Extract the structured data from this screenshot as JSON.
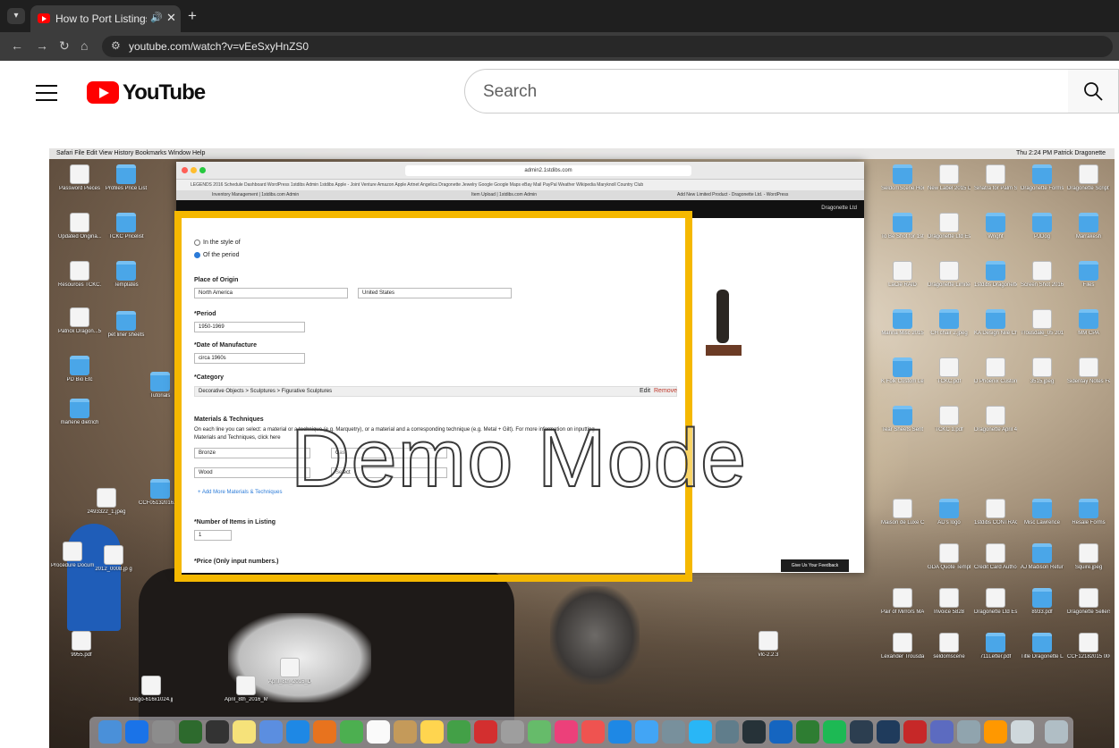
{
  "browser": {
    "tab_title": "How to Port Listings from",
    "new_tab_symbol": "+",
    "url": "youtube.com/watch?v=vEeSxyHnZS0"
  },
  "youtube": {
    "logo_text": "YouTube",
    "search_placeholder": "Search"
  },
  "video": {
    "mac_menubar_left": "Safari   File   Edit   View   History   Bookmarks   Window   Help",
    "mac_menubar_right": "Thu 2:24 PM   Patrick Dragonette",
    "inner_url": "admin2.1stdibs.com",
    "inner_bookmarks": "LEGENDS 2016 Schedule   Dashboard   WordPress   1stdibs   Admin 1stdibs   Apple - Joint Venture   Amazon   Apple   Artnet   Angelica   Dragonette Jewelry   Google   Google Maps   eBay   Mail   PayPal   Weather   Wikipedia   Maryknoll Country Club",
    "inner_tabs": [
      "Inventory Management | 1stdibs.com Admin",
      "Item Upload | 1stdibs.com Admin",
      "Add New Limited Product - Dragonette Ltd. - WordPress"
    ],
    "inner_user": "Dragonette Ltd",
    "form": {
      "radio_style": "In the style of",
      "radio_period": "Of the period",
      "place_of_origin_label": "Place of Origin",
      "place_of_origin_value": "North America",
      "country_value": "United States",
      "period_label": "*Period",
      "period_value": "1950-1969",
      "date_label": "*Date of Manufacture",
      "date_value": "circa 1960s",
      "category_label": "*Category",
      "category_value": "Decorative Objects > Sculptures > Figurative Sculptures",
      "edit_label": "Edit",
      "remove_label": "Remove",
      "materials_label": "Materials & Techniques",
      "materials_help": "On each line you can select: a material or a technique (e.g. Marquetry), or a material and a corresponding technique (e.g. Metal + Gilt). For more information on inputting",
      "materials_help2": "Materials and Techniques, click here",
      "material_1": "Bronze",
      "technique_1": "Cast",
      "material_2": "Wood",
      "technique_2": "Select",
      "add_more": "+ Add More Materials & Techniques",
      "items_label": "*Number of Items in Listing",
      "items_value": "1",
      "price_label": "*Price (Only input numbers.)"
    },
    "watermark": "Demo Mode",
    "feedback_button": "Give Us Your Feedback",
    "desktop_icons": [
      "Password Pieces",
      "Profiles Price List",
      "Updated Origina...9_2105",
      "TCKC Pricelist",
      "Resources TCKC.docx",
      "Templates",
      "Patrick Dragon...5.docx",
      "pet liner sheets",
      "PD Bio Etc",
      "Tutorials",
      "marlene dietrich",
      "SeldomScene Horrigs...es.jpeg",
      "New Label 2015 Dimensions",
      "Sinatra for Palm Springs copy",
      "Dragonette Forms",
      "Dragonette Script Logo.jpg",
      "To Be Shot for 1st Dibs",
      "Dragonette Ltd Estima...Homes",
      "Wright",
      "PJDog",
      "Marrakesh",
      "LaCie RAID",
      "Dragonette Limited...ogo.jpeg",
      "1stdibs Dragonette",
      "Screen Shot 2016-03-28",
      "Files",
      "Marina Misc 2015",
      "CH chair 2.jpeg",
      "KA Design Nile Chairs",
      "Trousdale_05 2015.pdf",
      "MM CPA",
      "K Folk Custom Lexington",
      "TCKC.pdf",
      "D Phoenix Custom Pedals",
      "3515.jpeg",
      "Sideritay Notes February 21",
      "Tear Sheets Sent",
      "TCKC 1.pdf",
      "Dragonette April 4th Mar 1003.jpg",
      "Maison de Luxe Cover.pdf",
      "AD's logo",
      "1stdibs CONTRACT",
      "Misc Lawrence",
      "Resale Forms",
      "GDA Quote Template",
      "Credit Card Authori...rm.pdf",
      "AJ Madison Return",
      "Squire.jpeg",
      "Pair of Mirrors MAIN.jpg",
      "Invoice 5828",
      "Dragonette Ltd Estimate 1304",
      "8933.pdf",
      "Dragonette Sellers Permit",
      "Lexander Trousdale.pdf",
      "seldomscene",
      "711Letter.pdf",
      "Title Dragonette Lamp",
      "CCF12182015 0001.jpg",
      "vlc-2.2.3",
      "9955.pdf",
      "2493322_1.jpeg",
      "CCF05132016.pdf",
      "Procedure Documents",
      "2012_0008.jp g",
      "Diego-616x1024.jpg",
      "April_8th_2016_Main_3...43_1.jpg",
      "April_8th_2016_Detail...43_1.jpg",
      "April_8th_2016_Detail_...43_1.jpg"
    ]
  }
}
